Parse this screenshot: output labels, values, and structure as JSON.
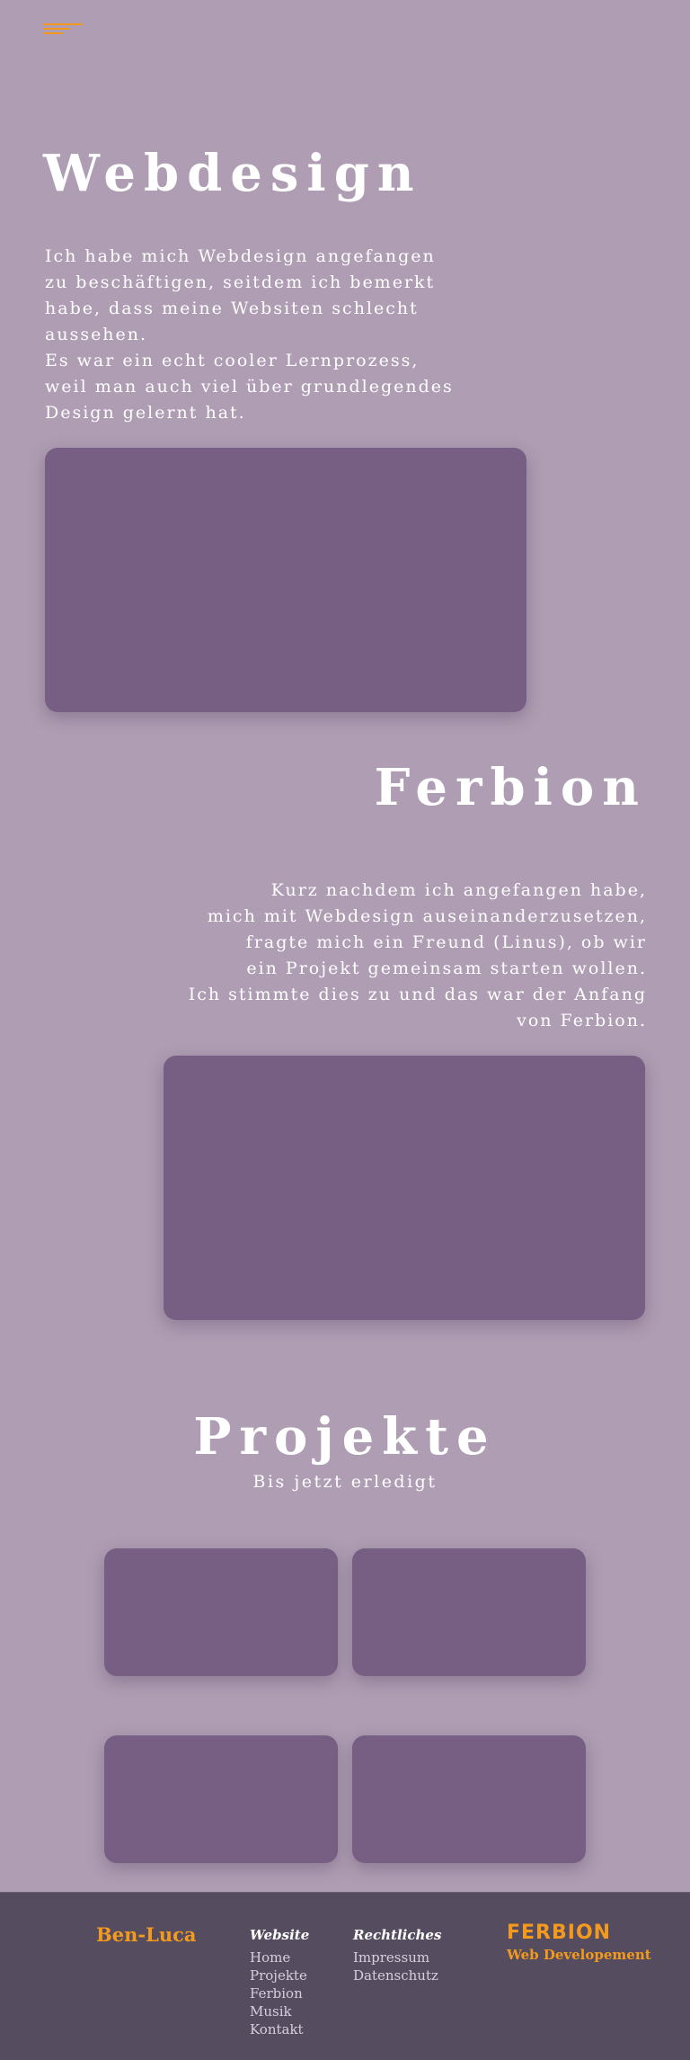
{
  "header": {
    "logo_icon": "ferbion-logo-icon",
    "accent_color": "#f39a1e"
  },
  "webdesign": {
    "title": "Webdesign",
    "lines": [
      "Ich habe mich Webdesign angefangen",
      "zu beschäftigen, seitdem ich bemerkt",
      "habe, dass meine Websiten schlecht",
      "aussehen.",
      "Es war ein echt cooler Lernprozess,",
      "weil man auch viel über grundlegendes",
      "Design gelernt hat."
    ]
  },
  "ferbion": {
    "title": "Ferbion",
    "lines": [
      "Kurz nachdem ich angefangen habe,",
      "mich mit Webdesign auseinanderzusetzen,",
      "fragte mich ein Freund (Linus), ob wir",
      "ein Projekt gemeinsam starten wollen.",
      "Ich stimmte dies zu und das war der Anfang",
      "von Ferbion."
    ]
  },
  "projekte": {
    "title": "Projekte",
    "subtitle": "Bis jetzt erledigt",
    "card_count": 4
  },
  "footer": {
    "brand": "Ben-Luca",
    "website": {
      "heading": "Website",
      "links": [
        "Home",
        "Projekte",
        "Ferbion",
        "Musik",
        "Kontakt"
      ]
    },
    "legal": {
      "heading": "Rechtliches",
      "links": [
        "Impressum",
        "Datenschutz"
      ]
    },
    "logo_text": "FERBION",
    "tagline": "Web Developement"
  },
  "colors": {
    "background": "#ae9db3",
    "card": "#775f84",
    "footer": "#554c5f",
    "accent": "#f39a1e"
  }
}
